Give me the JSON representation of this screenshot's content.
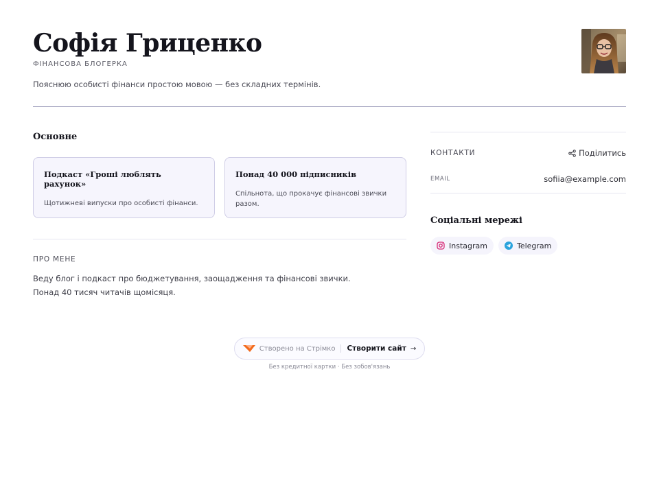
{
  "profile": {
    "name": "Софія Гриценко",
    "role": "ФІНАНСОВА БЛОГЕРКА",
    "tagline": "Пояснюю особисті фінанси простою мовою — без складних термінів."
  },
  "main": {
    "section_title": "Основне",
    "cards": [
      {
        "title": "Подкаст «Гроші люблять рахунок»",
        "description": "Щотижневі випуски про особисті фінанси."
      },
      {
        "title": "Понад 40 000 підписників",
        "description": "Спільнота, що прокачує фінансові звички разом."
      }
    ],
    "about_label": "ПРО МЕНЕ",
    "about_text": "Веду блог і подкаст про бюджетування, заощадження та фінансові звички. Понад 40 тисяч читачів щомісяця."
  },
  "aside": {
    "contacts_label": "КОНТАКТИ",
    "share_label": "Поділитись",
    "email_label": "EMAIL",
    "email_value": "sofiia@example.com",
    "social_title": "Соціальні мережі",
    "social": [
      {
        "label": "Instagram",
        "icon": "instagram-icon",
        "color": "#d62976"
      },
      {
        "label": "Telegram",
        "icon": "telegram-icon",
        "color": "#2aa3dd"
      }
    ]
  },
  "footer": {
    "made_with": "Створено на Стрімко",
    "cta": "Створити сайт",
    "note": "Без кредитної картки · Без зобов'язань",
    "logo_color": "#f26b1d"
  },
  "colors": {
    "accent": "#f26b1d",
    "card_bg": "#f6f5fd",
    "card_border": "#cfcde6",
    "divider": "#9a9ab8"
  }
}
